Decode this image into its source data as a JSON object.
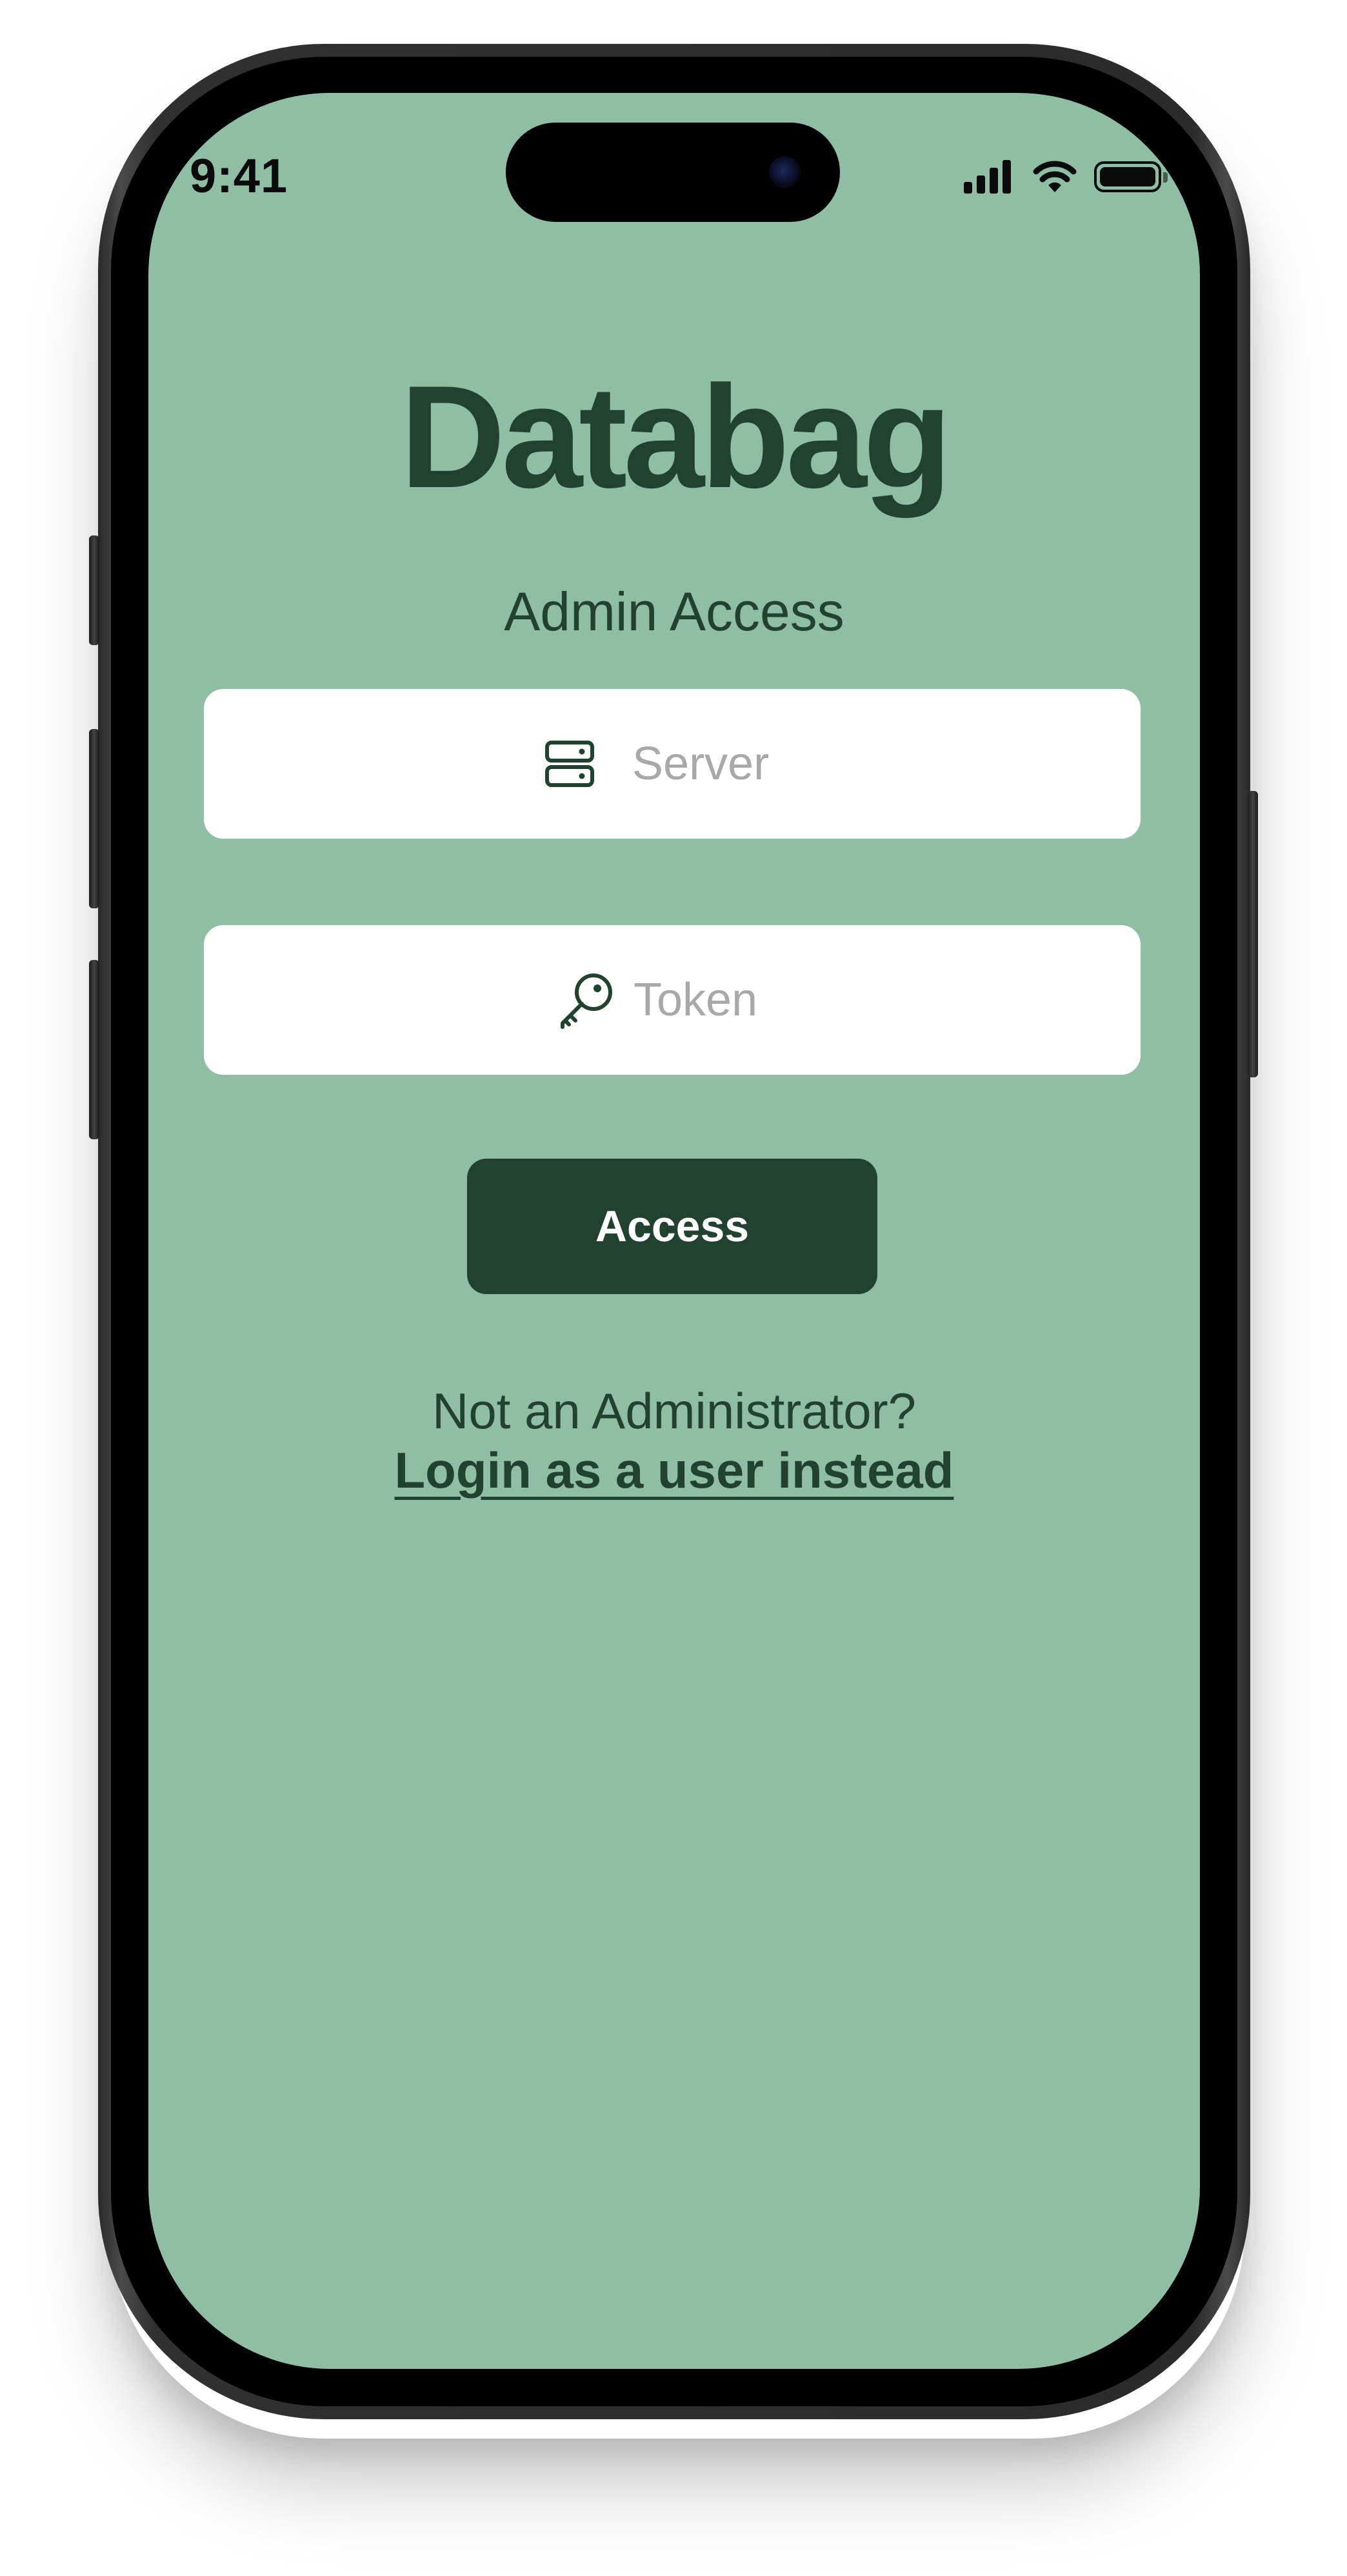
{
  "status_bar": {
    "time": "9:41",
    "icons": [
      "signal-icon",
      "wifi-icon",
      "battery-icon"
    ]
  },
  "app": {
    "title": "Databag",
    "subtitle": "Admin Access"
  },
  "form": {
    "server": {
      "placeholder": "Server",
      "value": "",
      "icon": "server-icon"
    },
    "token": {
      "placeholder": "Token",
      "value": "",
      "icon": "key-icon"
    },
    "submit_label": "Access"
  },
  "footer": {
    "prompt": "Not an Administrator?",
    "link_label": "Login as a user instead"
  },
  "colors": {
    "background": "#8fbea4",
    "primary": "#21422f",
    "field": "#ffffff",
    "placeholder": "#a8a8a8"
  }
}
